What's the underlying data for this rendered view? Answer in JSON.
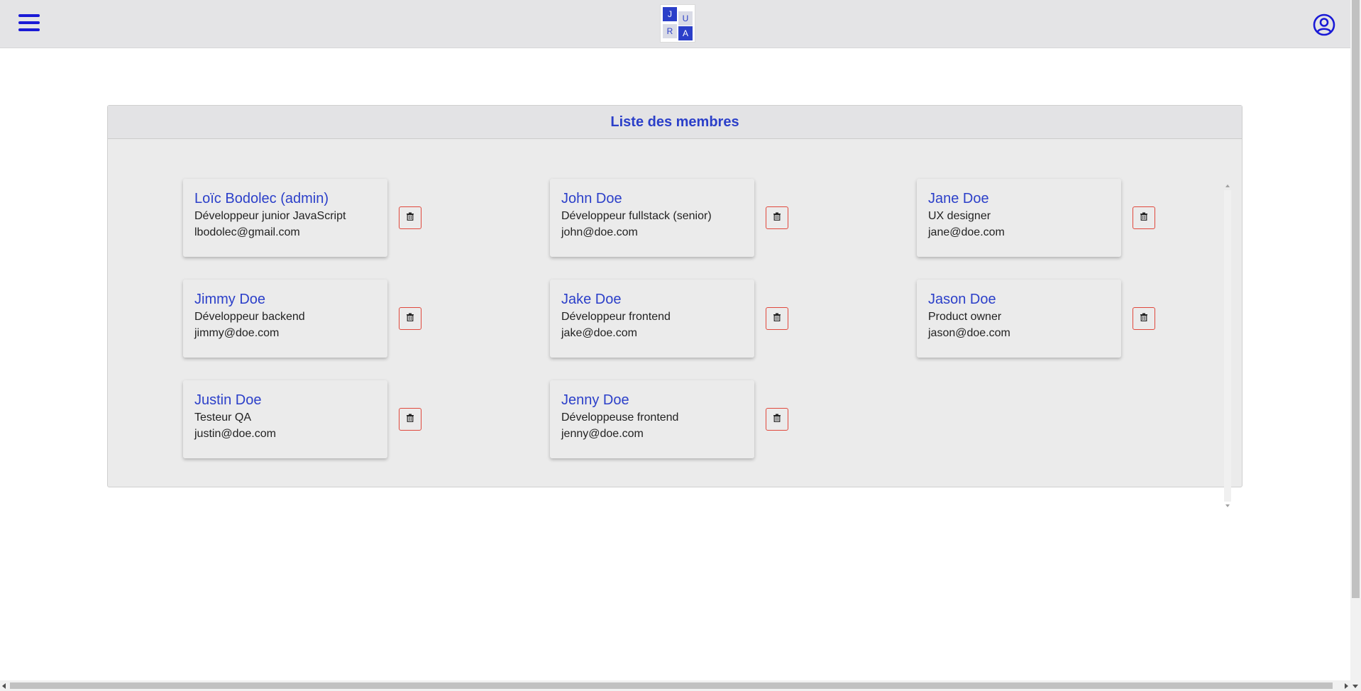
{
  "header": {
    "logo_letters": [
      "J",
      "U",
      "R",
      "A"
    ],
    "menu_icon": "menu-icon",
    "account_icon": "user-circle-icon"
  },
  "panel": {
    "title": "Liste des membres"
  },
  "members": [
    {
      "name": "Loïc Bodolec (admin)",
      "role": "Développeur junior JavaScript",
      "email": "lbodolec@gmail.com"
    },
    {
      "name": "John Doe",
      "role": "Développeur fullstack (senior)",
      "email": "john@doe.com"
    },
    {
      "name": "Jane Doe",
      "role": "UX designer",
      "email": "jane@doe.com"
    },
    {
      "name": "Jimmy Doe",
      "role": "Développeur backend",
      "email": "jimmy@doe.com"
    },
    {
      "name": "Jake Doe",
      "role": "Développeur frontend",
      "email": "jake@doe.com"
    },
    {
      "name": "Jason Doe",
      "role": "Product owner",
      "email": "jason@doe.com"
    },
    {
      "name": "Justin Doe",
      "role": "Testeur QA",
      "email": "justin@doe.com"
    },
    {
      "name": "Jenny Doe",
      "role": "Développeuse frontend",
      "email": "jenny@doe.com"
    }
  ],
  "colors": {
    "accent": "#2b3fc9",
    "menu_blue": "#1a1ad6",
    "delete_border": "#e0483c"
  },
  "icons": {
    "delete": "trash-icon"
  }
}
